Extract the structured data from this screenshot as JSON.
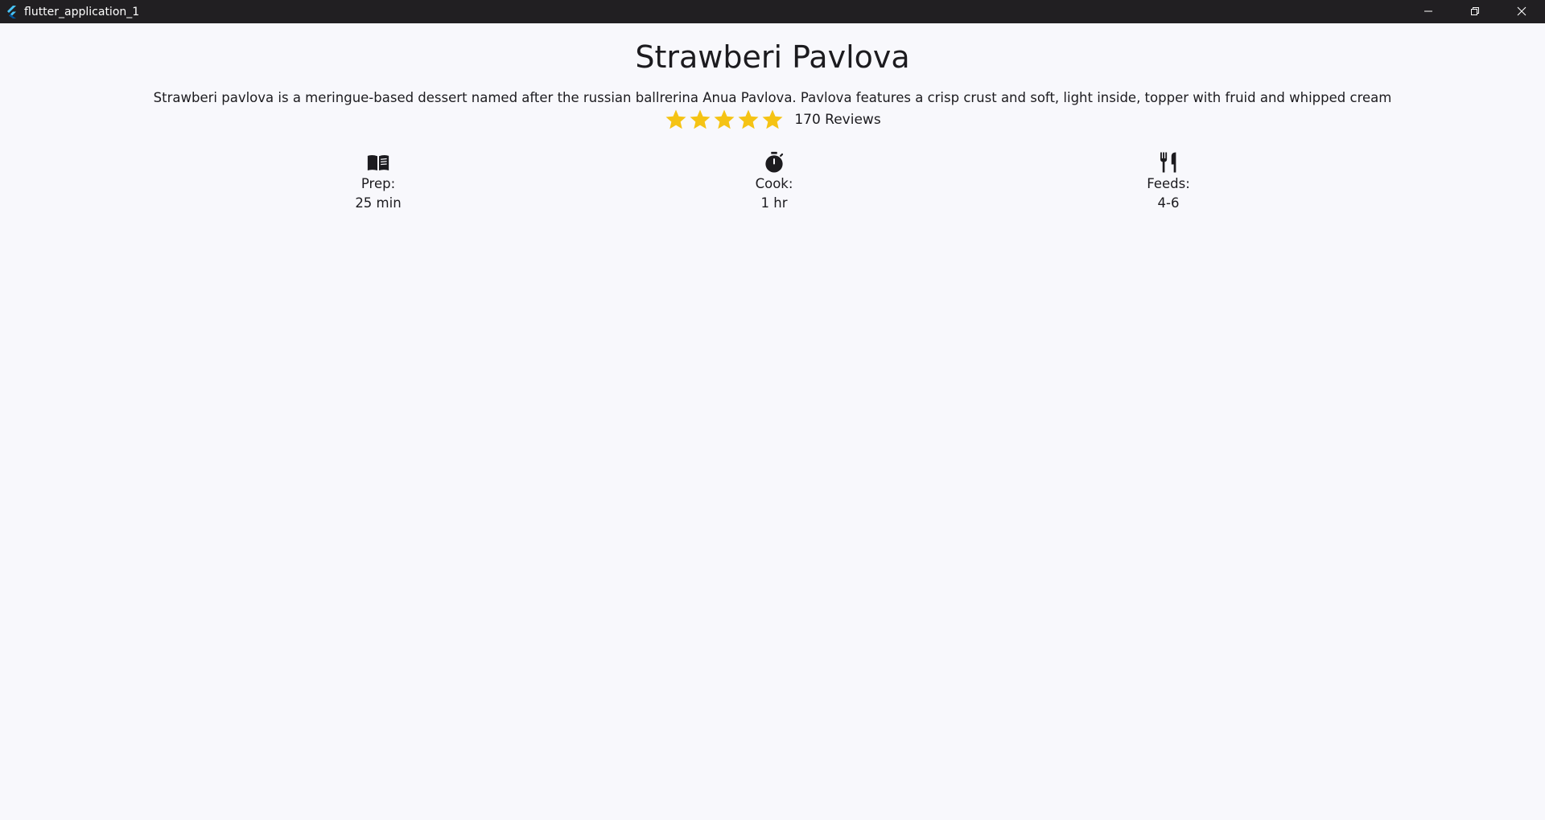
{
  "window": {
    "title": "flutter_application_1",
    "controls": {
      "minimize_icon": "minimize-icon",
      "restore_icon": "restore-icon",
      "close_icon": "close-icon"
    }
  },
  "recipe": {
    "title": "Strawberi Pavlova",
    "description": "Strawberi pavlova is a meringue-based dessert named after the russian ballrerina Anua Pavlova. Pavlova features a crisp crust and soft, light inside, topper with fruid and whipped cream",
    "rating": {
      "stars": 5,
      "max_stars": 5,
      "star_color": "#f5c314",
      "reviews": "170 Reviews"
    },
    "info": [
      {
        "icon": "book-icon",
        "label": "Prep:",
        "value": "25 min"
      },
      {
        "icon": "timer-icon",
        "label": "Cook:",
        "value": "1 hr"
      },
      {
        "icon": "restaurant-icon",
        "label": "Feeds:",
        "value": "4-6"
      }
    ]
  },
  "colors": {
    "titlebar_bg": "#211f22",
    "page_bg": "#f8f8fc",
    "text": "#1c1b1f",
    "flutter_blue": "#47c5fb"
  }
}
